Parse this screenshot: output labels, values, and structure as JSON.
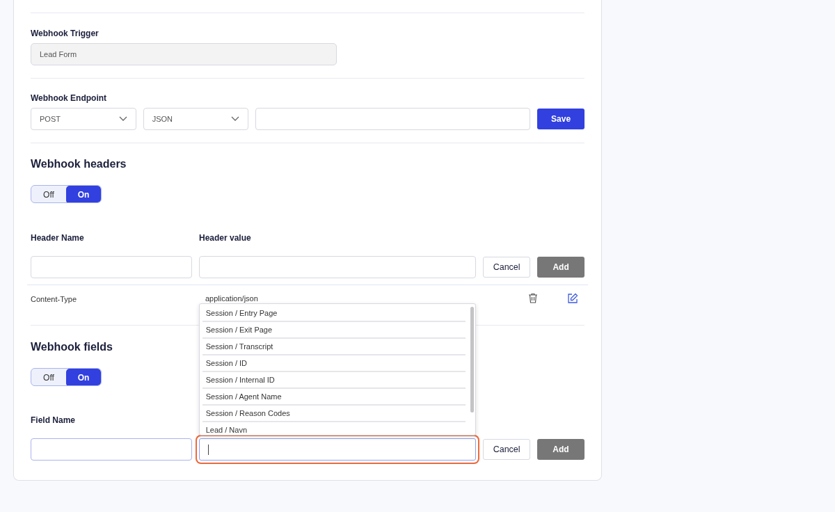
{
  "trigger": {
    "label": "Webhook Trigger",
    "value": "Lead Form"
  },
  "endpoint": {
    "label": "Webhook Endpoint",
    "method": "POST",
    "format": "JSON",
    "save_button": "Save"
  },
  "headers": {
    "title": "Webhook headers",
    "toggle": [
      {
        "label": "Off",
        "selected": false
      },
      {
        "label": "On",
        "selected": true
      }
    ],
    "name_label": "Header Name",
    "value_label": "Header value",
    "cancel_button": "Cancel",
    "add_button": "Add",
    "rows": [
      {
        "name": "Content-Type",
        "value": "application/json"
      }
    ]
  },
  "fields": {
    "title": "Webhook fields",
    "toggle": [
      {
        "label": "Off",
        "selected": false
      },
      {
        "label": "On",
        "selected": true
      }
    ],
    "name_label": "Field Name",
    "cancel_button": "Cancel",
    "add_button": "Add",
    "value_focused": true,
    "dropdown": [
      "Session / Entry Page",
      "Session / Exit Page",
      "Session / Transcript",
      "Session / ID",
      "Session / Internal ID",
      "Session / Agent Name",
      "Session / Reason Codes",
      "Lead / Navn"
    ]
  }
}
